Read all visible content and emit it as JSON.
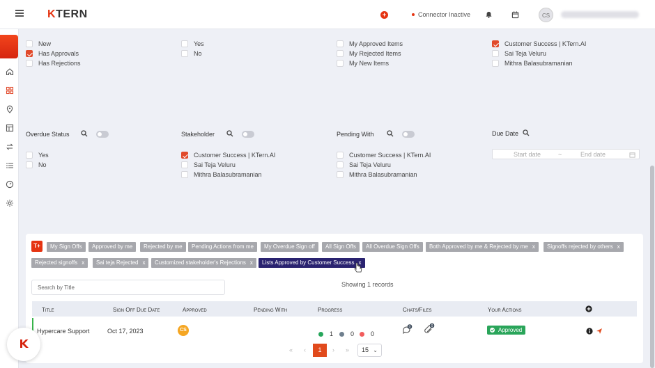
{
  "header": {
    "logo_k": "K",
    "logo_rest": "TERN",
    "connector_status": "Connector Inactive",
    "avatar_initials": "CS"
  },
  "filters_top": {
    "col1": [
      {
        "label": "New",
        "checked": false
      },
      {
        "label": "Has Approvals",
        "checked": true
      },
      {
        "label": "Has Rejections",
        "checked": false
      }
    ],
    "col2": [
      {
        "label": "Yes",
        "checked": false
      },
      {
        "label": "No",
        "checked": false
      }
    ],
    "col3": [
      {
        "label": "My Approved Items",
        "checked": false
      },
      {
        "label": "My Rejected Items",
        "checked": false
      },
      {
        "label": "My New Items",
        "checked": false
      }
    ],
    "col4": [
      {
        "label": "Customer Success | KTern.AI",
        "checked": true
      },
      {
        "label": "Sai Teja Veluru",
        "checked": false
      },
      {
        "label": "Mithra Balasubramanian",
        "checked": false
      }
    ]
  },
  "filters_mid": {
    "overdue": {
      "title": "Overdue Status",
      "options": [
        {
          "label": "Yes",
          "checked": false
        },
        {
          "label": "No",
          "checked": false
        }
      ]
    },
    "stakeholder": {
      "title": "Stakeholder",
      "options": [
        {
          "label": "Customer Success | KTern.AI",
          "checked": true
        },
        {
          "label": "Sai Teja Veluru",
          "checked": false
        },
        {
          "label": "Mithra Balasubramanian",
          "checked": false
        }
      ]
    },
    "pending": {
      "title": "Pending With",
      "options": [
        {
          "label": "Customer Success | KTern.AI",
          "checked": false
        },
        {
          "label": "Sai Teja Veluru",
          "checked": false
        },
        {
          "label": "Mithra Balasubramanian",
          "checked": false
        }
      ]
    },
    "due_date": {
      "title": "Due Date",
      "start_placeholder": "Start date",
      "separator": "~",
      "end_placeholder": "End date"
    }
  },
  "card": {
    "tplus_label": "T+",
    "chips": [
      {
        "label": "My Sign Offs",
        "closable": false,
        "active": false
      },
      {
        "label": "Approved by me",
        "closable": false,
        "active": false
      },
      {
        "label": "Rejected by me",
        "closable": false,
        "active": false
      },
      {
        "label": "Pending Actions from me",
        "closable": false,
        "active": false
      },
      {
        "label": "My Overdue Sign off",
        "closable": false,
        "active": false
      },
      {
        "label": "All Sign Offs",
        "closable": false,
        "active": false
      },
      {
        "label": "All Overdue Sign Offs",
        "closable": false,
        "active": false
      },
      {
        "label": "Both Approved by me & Rejected by me",
        "closable": true,
        "active": false
      },
      {
        "label": "Signoffs rejected by others",
        "closable": true,
        "active": false
      },
      {
        "label": "Rejected signoffs",
        "closable": true,
        "active": false
      },
      {
        "label": "Sai teja Rejected",
        "closable": true,
        "active": false
      },
      {
        "label": "Customized stakeholder's Rejections",
        "closable": true,
        "active": false
      },
      {
        "label": "Lists Approved by Customer Success",
        "closable": true,
        "active": true
      }
    ],
    "chip_close": "x",
    "search_placeholder": "Search by Title",
    "showing_text": "Showing 1 records",
    "columns": {
      "title": "Title",
      "due": "Sign Off Due Date",
      "approved": "Approved",
      "pending": "Pending With",
      "progress": "Progress",
      "chats": "Chats/Files",
      "actions": "Your Actions"
    },
    "row": {
      "title": "Hypercare Support",
      "due": "Oct 17, 2023",
      "approved_initials": "CS",
      "progress": [
        {
          "value": "1",
          "color": "#26a65b"
        },
        {
          "value": "0",
          "color": "#6f7f8e"
        },
        {
          "value": "0",
          "color": "#f25c5c"
        }
      ],
      "chat_count": "0",
      "file_count": "0",
      "status": "Approved"
    },
    "pagination": {
      "first": "«",
      "prev": "‹",
      "current": "1",
      "next": "›",
      "last": "»",
      "page_size": "15",
      "chevron": "⌄"
    }
  }
}
